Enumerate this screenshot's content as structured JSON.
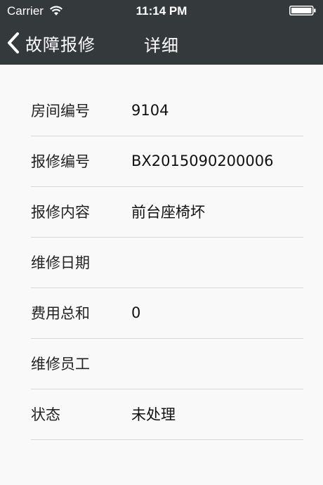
{
  "status_bar": {
    "carrier": "Carrier",
    "time": "11:14 PM",
    "wifi_icon": "wifi-icon",
    "battery_icon": "battery-icon"
  },
  "nav": {
    "back_label": "故障报修",
    "back_icon": "chevron-left-icon",
    "title": "详细"
  },
  "rows": [
    {
      "label": "房间编号",
      "value": "9104"
    },
    {
      "label": "报修编号",
      "value": "BX2015090200006"
    },
    {
      "label": "报修内容",
      "value": "前台座椅坏"
    },
    {
      "label": "维修日期",
      "value": ""
    },
    {
      "label": "费用总和",
      "value": "0"
    },
    {
      "label": "维修员工",
      "value": ""
    },
    {
      "label": "状态",
      "value": "未处理"
    }
  ],
  "colors": {
    "header_bg": "#34393b",
    "content_bg": "#f9f9f9",
    "divider": "#d8d8d8"
  }
}
